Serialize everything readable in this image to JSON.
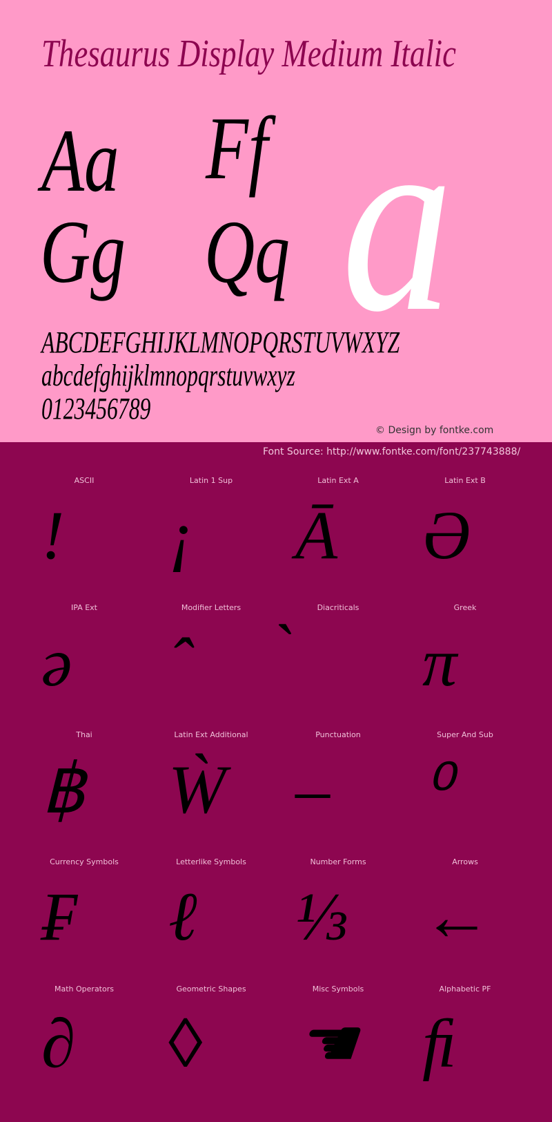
{
  "header": {
    "title": "Thesaurus Display Medium Italic"
  },
  "preview": {
    "pairs": [
      "Aa",
      "Ff",
      "Gg",
      "Qq"
    ],
    "big_glyph": "a",
    "uppercase": "ABCDEFGHIJKLMNOPQRSTUVWXYZ",
    "lowercase": "abcdefghijklmnopqrstuvwxyz",
    "digits": "0123456789",
    "credit": "© Design by fontke.com",
    "source": "Font Source: http://www.fontke.com/font/237743888/"
  },
  "colors": {
    "top_background": "#ff9ac8",
    "bottom_background": "#8d0650",
    "title_color": "#8d0650",
    "big_glyph_color": "#ffffff"
  },
  "blocks": [
    {
      "label": "ASCII",
      "glyph": "!"
    },
    {
      "label": "Latin 1 Sup",
      "glyph": "¡"
    },
    {
      "label": "Latin Ext A",
      "glyph": "Ā"
    },
    {
      "label": "Latin Ext B",
      "glyph": "Ə"
    },
    {
      "label": "IPA Ext",
      "glyph": "ə"
    },
    {
      "label": "Modifier Letters",
      "glyph": "ˆ"
    },
    {
      "label": "Diacriticals",
      "glyph": "̀"
    },
    {
      "label": "Greek",
      "glyph": "π"
    },
    {
      "label": "Thai",
      "glyph": "฿"
    },
    {
      "label": "Latin Ext Additional",
      "glyph": "Ẁ"
    },
    {
      "label": "Punctuation",
      "glyph": "–"
    },
    {
      "label": "Super And Sub",
      "glyph": "⁰"
    },
    {
      "label": "Currency Symbols",
      "glyph": "₣"
    },
    {
      "label": "Letterlike Symbols",
      "glyph": "ℓ"
    },
    {
      "label": "Number Forms",
      "glyph": "⅓"
    },
    {
      "label": "Arrows",
      "glyph": "←"
    },
    {
      "label": "Math Operators",
      "glyph": "∂"
    },
    {
      "label": "Geometric Shapes",
      "glyph": "◊"
    },
    {
      "label": "Misc Symbols",
      "glyph": "☚"
    },
    {
      "label": "Alphabetic PF",
      "glyph": "ﬁ"
    }
  ]
}
